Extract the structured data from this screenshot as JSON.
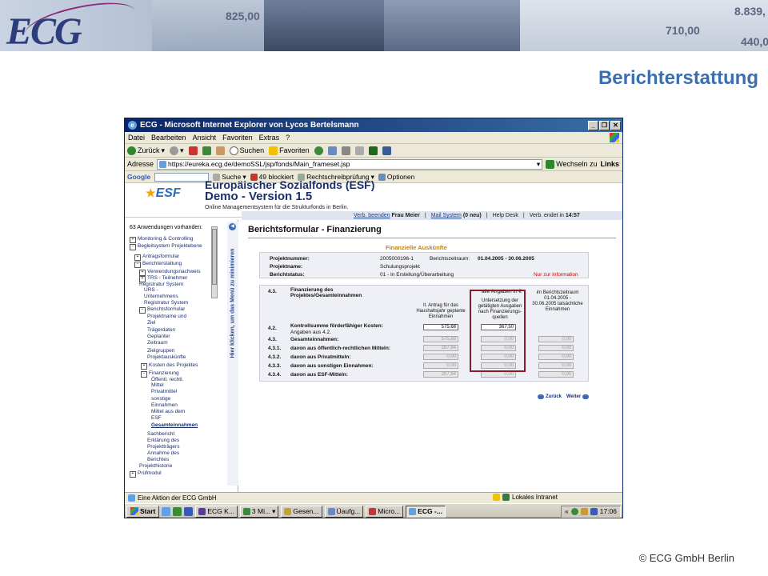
{
  "slide": {
    "title": "Berichterstattung",
    "copyright": "© ECG GmbH Berlin",
    "logo": "ECG",
    "banner_numbers": [
      "825,00",
      "8.839,",
      "710,00",
      "440,0"
    ]
  },
  "window": {
    "title": "ECG - Microsoft Internet Explorer von Lycos Bertelsmann",
    "menu": [
      "Datei",
      "Bearbeiten",
      "Ansicht",
      "Favoriten",
      "Extras",
      "?"
    ],
    "toolbar": {
      "back": "Zurück",
      "search": "Suchen",
      "favorites": "Favoriten"
    },
    "address_label": "Adresse",
    "address_value": "https://eureka.ecg.de/demoSSL/jsp/fonds/Main_frameset.jsp",
    "go_label": "Wechseln zu",
    "links_label": "Links",
    "google": {
      "brand": "Google",
      "search": "Suche",
      "blocked": "49 blockiert",
      "spell": "Rechtschreibprüfung",
      "options": "Optionen"
    }
  },
  "esf": {
    "logo": "ESF",
    "title_cut": "Europäischer Sozialfonds (ESF)",
    "title": "Demo - Version 1.5",
    "subtitle": "Online Managementsystem für die Strukturfonds in Berlin.",
    "status": {
      "logout": "Verb. beenden",
      "user": "Frau Meier",
      "mail": "Mail System",
      "mail_count": "(0 neu)",
      "help": "Help Desk",
      "expires_label": "Verb. endet in",
      "expires": "14:57"
    }
  },
  "left": {
    "count_text": "63 Anwendungen vorhanden:",
    "vertical_text": "Hier klicken, um das Menü zu minimieren",
    "items": [
      "Monitoring & Controlling",
      "Begleitsystem Projektebene",
      "Antragsformular",
      "Berichterstattung",
      "Verwendungsnachweis",
      "TRS - Teilnehmer Registratur System",
      "URS - Unternehmens Registratur System",
      "Berichtsformular",
      "Projektname und Ziel",
      "Trägerdaten",
      "Geplanter Zeitraum",
      "Zielgruppen",
      "Projektauskünfte",
      "Kosten des Projektes",
      "Finanzierung",
      "Öffentl. rechtl. Mittel",
      "Privatmittel",
      "sonstige Einnahmen",
      "Mittel aus dem ESF",
      "Gesamteinnahmen",
      "Sachbericht",
      "Erklärung des Projektträgers",
      "Annahme des Berichtes",
      "Projekthistorie",
      "Prüfmodul"
    ]
  },
  "form": {
    "title": "Berichtsformular - Finanzierung",
    "section": "Finanzielle Auskünfte",
    "info": {
      "projektnummer_label": "Projektnummer:",
      "projektnummer": "2005000196-1",
      "zeitraum_label": "Berichtszeitraum:",
      "zeitraum": "01.04.2005 - 30.06.2005",
      "projektname_label": "Projektname:",
      "projektname": "Schulungsprojekt",
      "status_label": "Berichtstatus:",
      "status": "01 - In Erstellung/Überarbeitung",
      "readonly_note": "Nur zur Information"
    },
    "table": {
      "sec_num": "4.3.",
      "sec_title": "Finanzierung des Projektes/Gesamteinnahmen",
      "units": "alle Angaben in €",
      "col1": "lt. Antrag für das Haushaltsjahr geplante Einnahmen",
      "col2": "Untersetzung der getätigten Ausgaben nach Finanzierungs-quellen",
      "col3": "im Berichtszeitraum 01.04.2005 - 30.06.2005 tatsächliche Einnahmen",
      "rows": [
        {
          "num": "4.2.",
          "label": "Kontrollsumme förderfähiger Kosten:",
          "sub": "Angaben aus 4.2.",
          "v1": "575,68",
          "v2": "367,50",
          "v3": ""
        },
        {
          "num": "4.3.",
          "label": "Gesamteinnahmen:",
          "sub": "",
          "v1": "575,68",
          "v2": "0,00",
          "v3": "0,00"
        },
        {
          "num": "4.3.1.",
          "label": "davon aus öffentlich-rechtlichen Mitteln:",
          "sub": "",
          "v1": "287,84",
          "v2": "0,00",
          "v3": "0,00"
        },
        {
          "num": "4.3.2.",
          "label": "davon aus Privatmitteln:",
          "sub": "",
          "v1": "0,00",
          "v2": "0,00",
          "v3": "0,00"
        },
        {
          "num": "4.3.3.",
          "label": "davon aus sonstigen Einnahmen:",
          "sub": "",
          "v1": "0,00",
          "v2": "0,00",
          "v3": "0,00"
        },
        {
          "num": "4.3.4.",
          "label": "davon aus ESF-Mitteln:",
          "sub": "",
          "v1": "287,84",
          "v2": "0,00",
          "v3": "0,00"
        }
      ]
    },
    "nav": {
      "back": "Zurück",
      "next": "Weiter"
    }
  },
  "statusbar": {
    "left": "Eine Aktion der ECG GmbH",
    "zone": "Lokales Intranet"
  },
  "taskbar": {
    "start": "Start",
    "tasks": [
      "ECG K...",
      "3 Mi...",
      "Gesen...",
      "Üaufg...",
      "Micro...",
      "ECG -..."
    ],
    "clock": "17:06"
  }
}
